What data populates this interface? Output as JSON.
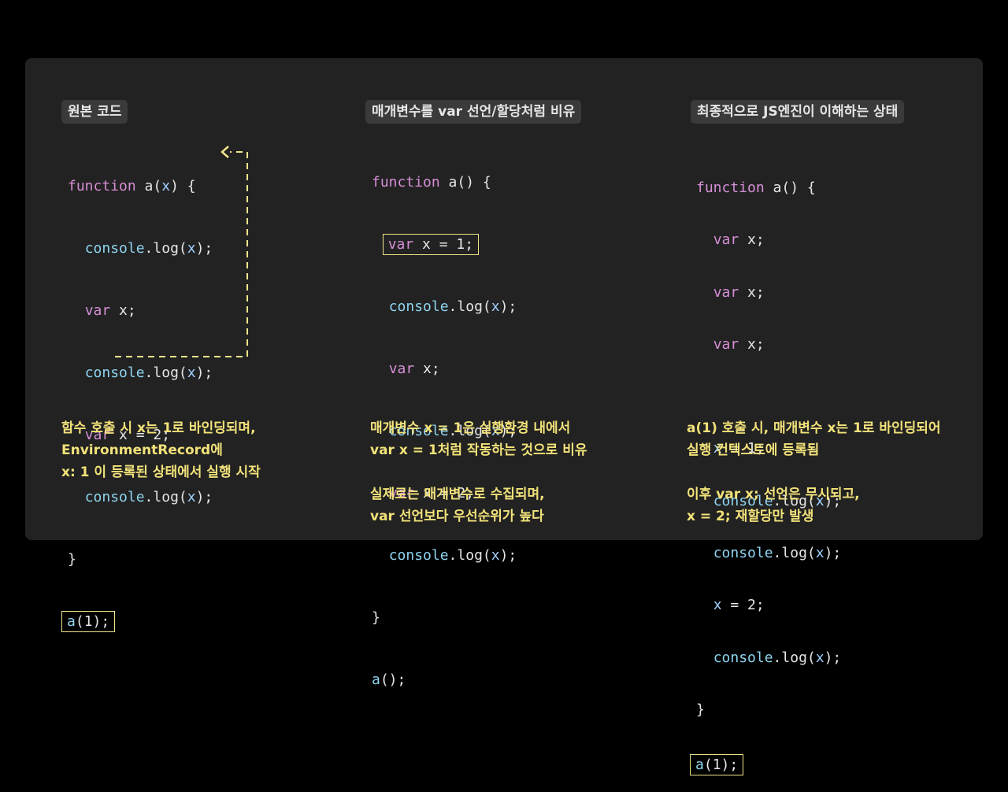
{
  "columns": [
    {
      "tag": "원본 코드",
      "notes": [
        "함수 호출 시 x는 1로 바인딩되며,",
        "EnvironmentRecord에",
        "x: 1 이 등록된 상태에서 실행 시작"
      ]
    },
    {
      "tag": "매개변수를 var 선언/할당처럼 비유",
      "notes": [
        "매개변수 x = 1은 실행환경 내에서",
        "var x = 1처럼 작동하는 것으로 비유",
        "",
        "실제로는 매개변수로 수집되며,",
        "var 선언보다 우선순위가 높다"
      ]
    },
    {
      "tag": "최종적으로 JS엔진이 이해하는 상태",
      "notes": [
        "a(1) 호출 시, 매개변수 x는 1로 바인딩되어",
        "실행 컨텍스트에 등록됨",
        "",
        "이후 var x; 선언은 무시되고,",
        "x = 2; 재할당만 발생"
      ]
    }
  ],
  "code": {
    "function_kw": "function",
    "fn_name": "a",
    "console": "console",
    "log": "log",
    "var_kw": "var",
    "x": "x",
    "one": "1",
    "two": "2",
    "call_arg": "1"
  },
  "colors": {
    "background": "#000000",
    "panel": "#222222",
    "tag_bg": "#3a3a3a",
    "keyword": "#d68fd6",
    "object": "#8fd4f0",
    "highlight": "#f0e68c",
    "note": "#f2e27a"
  }
}
